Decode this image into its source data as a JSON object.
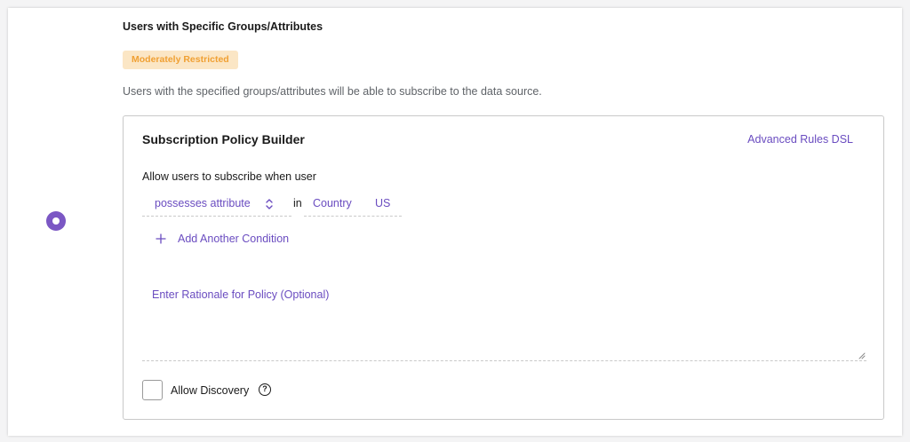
{
  "option": {
    "title": "Users with Specific Groups/Attributes",
    "badge": "Moderately Restricted",
    "description": "Users with the specified groups/attributes will be able to subscribe to the data source.",
    "selected": true
  },
  "builder": {
    "title": "Subscription Policy Builder",
    "dsl_link": "Advanced Rules DSL",
    "allow_label": "Allow users to subscribe when user",
    "condition": {
      "operator": "possesses attribute",
      "in_label": "in",
      "key": "Country",
      "value": "US"
    },
    "add_condition": "Add Another Condition",
    "rationale_placeholder": "Enter Rationale for Policy (Optional)",
    "allow_discovery": {
      "label": "Allow Discovery",
      "checked": false,
      "help_glyph": "?"
    }
  },
  "colors": {
    "accent": "#6a4cc0",
    "radio": "#7b57c4",
    "badge_bg": "#fbe6c5",
    "badge_text": "#f0a033"
  },
  "icons": [
    "radio-selected-icon",
    "updown-chevron-icon",
    "plus-icon",
    "resize-handle-icon",
    "help-icon"
  ]
}
